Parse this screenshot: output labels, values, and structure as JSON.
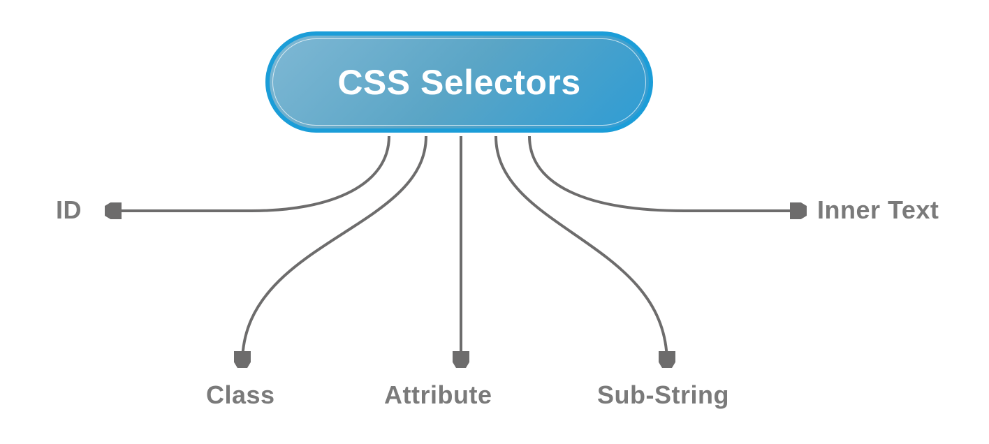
{
  "diagram": {
    "root": "CSS Selectors",
    "children": {
      "id": "ID",
      "class": "Class",
      "attribute": "Attribute",
      "substring": "Sub-String",
      "innertext": "Inner Text"
    }
  },
  "colors": {
    "node_gradient_from": "#7fb8d4",
    "node_gradient_to": "#2e9cd4",
    "node_border": "#1b9dd8",
    "text_leaf": "#7a7a7a",
    "connector": "#6d6c6c"
  }
}
